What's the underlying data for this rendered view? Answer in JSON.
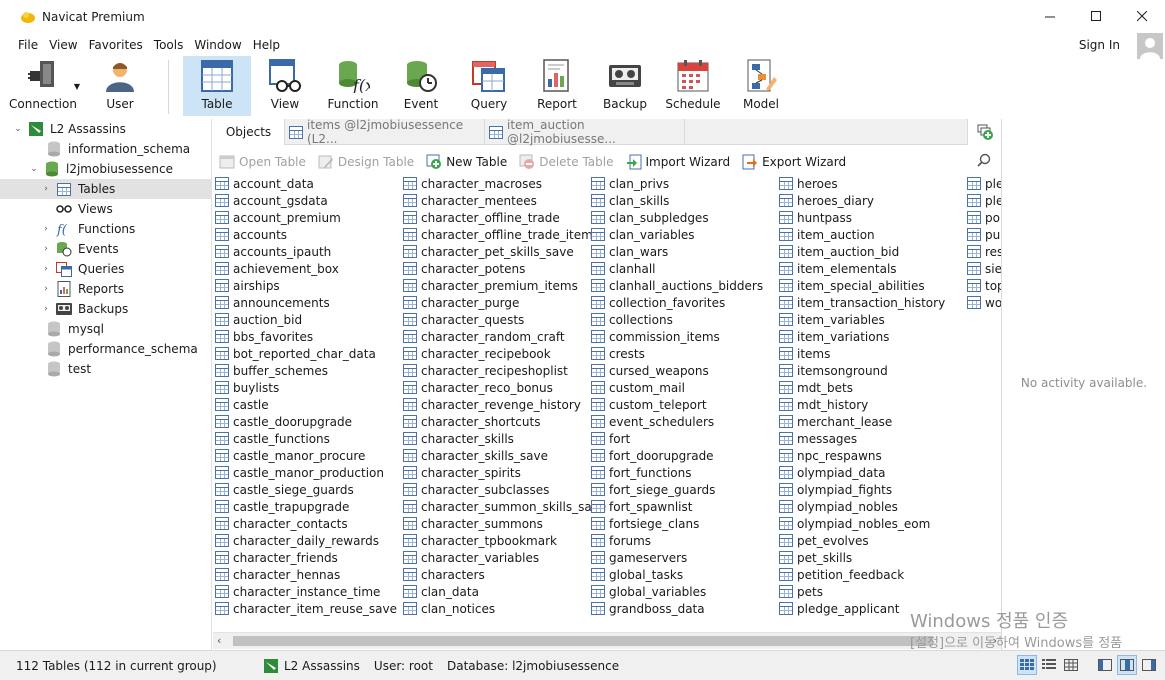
{
  "window": {
    "title": "Navicat Premium"
  },
  "menu": [
    "File",
    "View",
    "Favorites",
    "Tools",
    "Window",
    "Help"
  ],
  "signin_label": "Sign In",
  "toolbar": {
    "connection": "Connection",
    "user": "User",
    "buttons": [
      "Table",
      "View",
      "Function",
      "Event",
      "Query",
      "Report",
      "Backup",
      "Schedule",
      "Model"
    ],
    "active": "Table"
  },
  "tree": {
    "connection": "L2 Assassins",
    "databases": [
      "information_schema",
      "l2jmobiusessence",
      "mysql",
      "performance_schema",
      "test"
    ],
    "open_db_children": [
      "Tables",
      "Views",
      "Functions",
      "Events",
      "Queries",
      "Reports",
      "Backups"
    ]
  },
  "tabs": {
    "objects": "Objects",
    "doc1": "items @l2jmobiusessence (L2...",
    "doc2": "item_auction @l2jmobiusesse..."
  },
  "object_toolbar": [
    "Open Table",
    "Design Table",
    "New Table",
    "Delete Table",
    "Import Wizard",
    "Export Wizard"
  ],
  "tables": {
    "col1": [
      "account_data",
      "account_gsdata",
      "account_premium",
      "accounts",
      "accounts_ipauth",
      "achievement_box",
      "airships",
      "announcements",
      "auction_bid",
      "bbs_favorites",
      "bot_reported_char_data",
      "buffer_schemes",
      "buylists",
      "castle",
      "castle_doorupgrade",
      "castle_functions",
      "castle_manor_procure",
      "castle_manor_production",
      "castle_siege_guards",
      "castle_trapupgrade",
      "character_contacts",
      "character_daily_rewards",
      "character_friends",
      "character_hennas",
      "character_instance_time",
      "character_item_reuse_save"
    ],
    "col2": [
      "character_macroses",
      "character_mentees",
      "character_offline_trade",
      "character_offline_trade_items",
      "character_pet_skills_save",
      "character_potens",
      "character_premium_items",
      "character_purge",
      "character_quests",
      "character_random_craft",
      "character_recipebook",
      "character_recipeshoplist",
      "character_reco_bonus",
      "character_revenge_history",
      "character_shortcuts",
      "character_skills",
      "character_skills_save",
      "character_spirits",
      "character_subclasses",
      "character_summon_skills_save",
      "character_summons",
      "character_tpbookmark",
      "character_variables",
      "characters",
      "clan_data",
      "clan_notices"
    ],
    "col3": [
      "clan_privs",
      "clan_skills",
      "clan_subpledges",
      "clan_variables",
      "clan_wars",
      "clanhall",
      "clanhall_auctions_bidders",
      "collection_favorites",
      "collections",
      "commission_items",
      "crests",
      "cursed_weapons",
      "custom_mail",
      "custom_teleport",
      "event_schedulers",
      "fort",
      "fort_doorupgrade",
      "fort_functions",
      "fort_siege_guards",
      "fort_spawnlist",
      "fortsiege_clans",
      "forums",
      "gameservers",
      "global_tasks",
      "global_variables",
      "grandboss_data"
    ],
    "col4": [
      "heroes",
      "heroes_diary",
      "huntpass",
      "item_auction",
      "item_auction_bid",
      "item_elementals",
      "item_special_abilities",
      "item_transaction_history",
      "item_variables",
      "item_variations",
      "items",
      "itemsonground",
      "mdt_bets",
      "mdt_history",
      "merchant_lease",
      "messages",
      "npc_respawns",
      "olympiad_data",
      "olympiad_fights",
      "olympiad_nobles",
      "olympiad_nobles_eom",
      "pet_evolves",
      "pet_skills",
      "petition_feedback",
      "pets",
      "pledge_applicant"
    ],
    "col5": [
      "ple",
      "ple",
      "po",
      "pu",
      "res",
      "sie",
      "top",
      "wo"
    ]
  },
  "info_pane": {
    "empty": "No activity available."
  },
  "status": {
    "count": "112 Tables (112 in current group)",
    "connection": "L2 Assassins",
    "user": "User: root",
    "database": "Database: l2jmobiusessence"
  },
  "watermark": {
    "line1": "Windows 정품 인증",
    "line2": "[설정]으로 이동하여 Windows를 정품"
  }
}
